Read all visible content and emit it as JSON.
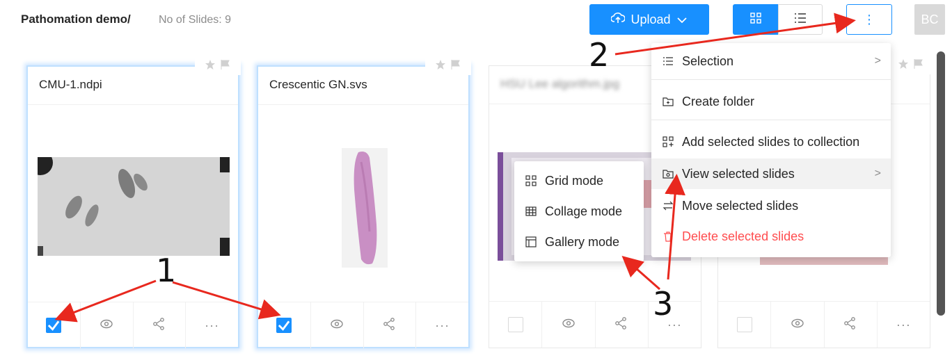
{
  "header": {
    "breadcrumb": "Pathomation demo/",
    "slide_count": "No of Slides: 9",
    "upload_label": "Upload",
    "avatar_initials": "BC"
  },
  "cards": [
    {
      "title": "CMU-1.ndpi",
      "selected": true
    },
    {
      "title": "Crescentic GN.svs",
      "selected": true
    },
    {
      "title": "HSU Lee algorithm.jpg",
      "selected": false
    },
    {
      "title": "",
      "selected": false
    }
  ],
  "menu": {
    "items": [
      {
        "label": "Selection"
      },
      {
        "label": "Create folder"
      },
      {
        "label": "Add selected slides to collection"
      },
      {
        "label": "View selected slides"
      },
      {
        "label": "Move selected slides"
      },
      {
        "label": "Delete selected slides"
      }
    ]
  },
  "submenu": {
    "items": [
      {
        "label": "Grid mode"
      },
      {
        "label": "Collage mode"
      },
      {
        "label": "Gallery mode"
      }
    ]
  },
  "annotations": {
    "one": "1",
    "two": "2",
    "three": "3"
  },
  "colors": {
    "accent": "#1890ff",
    "danger": "#ff4d4f",
    "arrow": "#e8281e"
  }
}
